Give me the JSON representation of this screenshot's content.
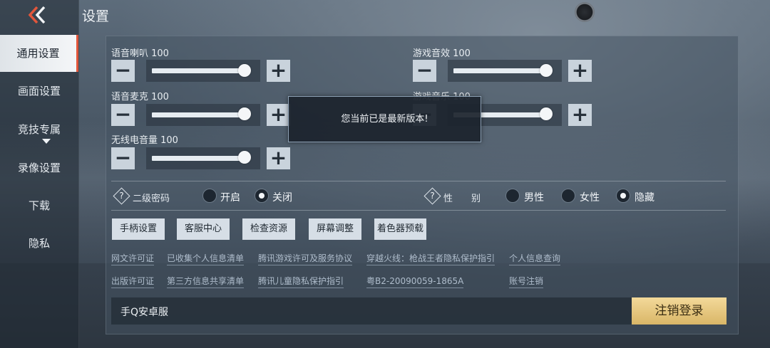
{
  "header": {
    "title": "设置"
  },
  "sidebar": {
    "items": [
      {
        "label": "通用设置",
        "active": true
      },
      {
        "label": "画面设置"
      },
      {
        "label": "竞技专属"
      },
      {
        "label": "录像设置"
      },
      {
        "label": "下载"
      },
      {
        "label": "隐私"
      }
    ]
  },
  "sliders": {
    "voice_speaker": {
      "label": "语音喇叭 100",
      "value": 100
    },
    "voice_mic": {
      "label": "语音麦克 100",
      "value": 100
    },
    "radio_volume": {
      "label": "无线电音量 100",
      "value": 100
    },
    "game_sfx": {
      "label": "游戏音效 100",
      "value": 100
    },
    "game_music": {
      "label": "游戏音乐 100",
      "value": 100
    }
  },
  "secondary_password": {
    "help": "?",
    "label": "二级密码",
    "options": [
      "开启",
      "关闭"
    ],
    "selected": "关闭"
  },
  "gender": {
    "help": "?",
    "label": "性　　别",
    "options": [
      "男性",
      "女性",
      "隐藏"
    ],
    "selected": "隐藏"
  },
  "actions": [
    "手柄设置",
    "客服中心",
    "检查资源",
    "屏幕调整",
    "着色器预载"
  ],
  "links": {
    "row1": [
      "网文许可证",
      "已收集个人信息清单",
      "腾讯游戏许可及服务协议",
      "穿越火线：枪战王者隐私保护指引",
      "个人信息查询"
    ],
    "row2": [
      "出版许可证",
      "第三方信息共享清单",
      "腾讯儿童隐私保护指引",
      "粤B2-20090059-1865A",
      "账号注销"
    ]
  },
  "account": {
    "platform": "手Q安卓服",
    "logout_label": "注销登录"
  },
  "toast": {
    "message": "您当前已是最新版本!"
  },
  "colors": {
    "accent": "#e2563b",
    "logout": "#e8c77f"
  }
}
